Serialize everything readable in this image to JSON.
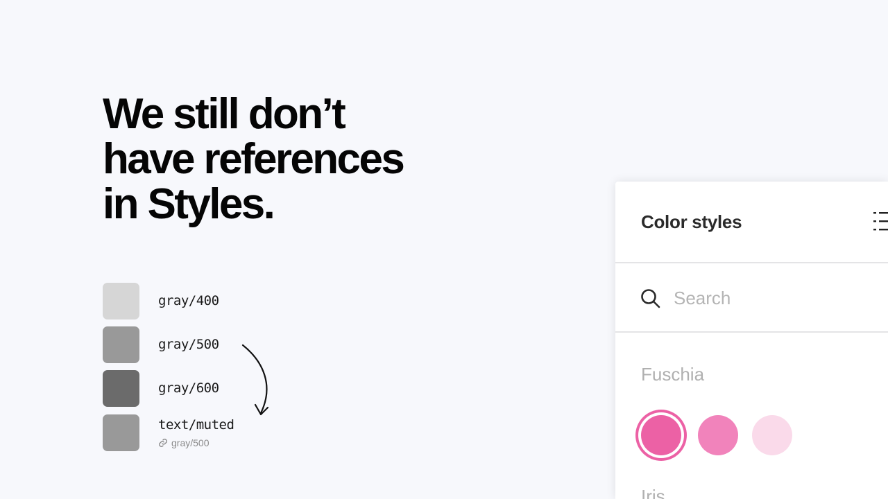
{
  "headline": {
    "line1": "We still don’t",
    "line2": "have references",
    "line3": "in Styles."
  },
  "swatches": [
    {
      "label": "gray/400",
      "color": "#d6d6d6"
    },
    {
      "label": "gray/500",
      "color": "#999999"
    },
    {
      "label": "gray/600",
      "color": "#6b6b6b"
    },
    {
      "label": "text/muted",
      "color": "#999999",
      "reference": "gray/500"
    }
  ],
  "panel": {
    "title": "Color styles",
    "search_placeholder": "Search",
    "groups": [
      {
        "name": "Fuschia",
        "colors": [
          {
            "color": "#ec61a5",
            "selected": true
          },
          {
            "color": "#f183bb",
            "selected": false
          },
          {
            "color": "#fadaea",
            "selected": false
          }
        ]
      },
      {
        "name": "Iris"
      }
    ]
  },
  "icons": [
    "link-icon",
    "curved-arrow-icon",
    "list-view-icon",
    "search-icon"
  ]
}
